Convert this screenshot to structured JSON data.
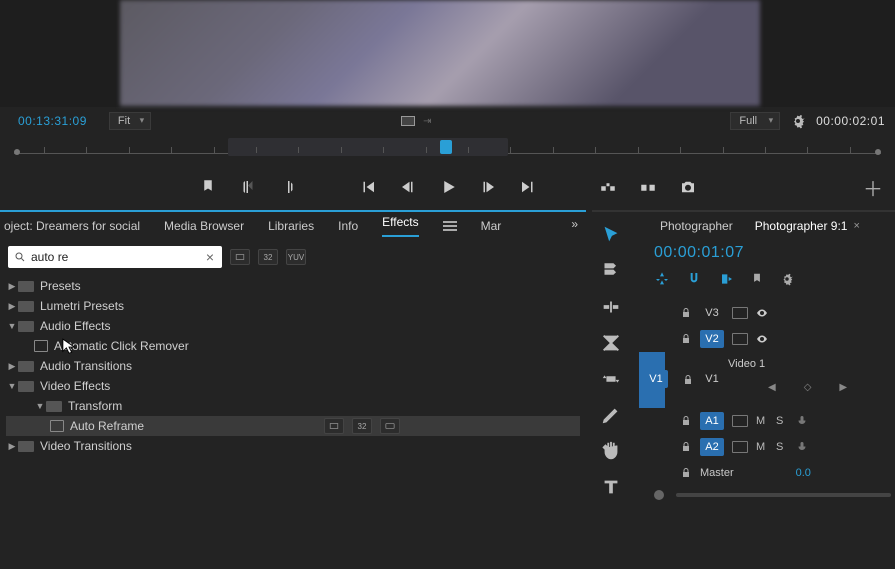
{
  "monitor": {
    "left_timecode": "00:13:31:09",
    "zoom": "Fit",
    "resolution": "Full",
    "right_timecode": "00:00:02:01"
  },
  "panel_left": {
    "project_tab": "oject: Dreamers for social",
    "tabs": [
      "Media Browser",
      "Libraries",
      "Info",
      "Effects",
      "Mar"
    ],
    "active_tab": "Effects",
    "search_value": "auto re",
    "tree": {
      "presets": "Presets",
      "lumetri": "Lumetri Presets",
      "audio_fx": "Audio Effects",
      "auto_click": "Automatic Click Remover",
      "audio_tr": "Audio Transitions",
      "video_fx": "Video Effects",
      "transform": "Transform",
      "auto_reframe": "Auto Reframe",
      "video_tr": "Video Transitions"
    }
  },
  "timeline": {
    "tabs": [
      "Photographer",
      "Photographer 9:1"
    ],
    "active_tab": 1,
    "timecode": "00:00:01:07",
    "tracks": {
      "v3": "V3",
      "v2": "V2",
      "v1": "V1",
      "v1_src": "V1",
      "clip": "Video 1",
      "a1": "A1",
      "a2": "A2",
      "master": "Master",
      "master_val": "0.0",
      "m": "M",
      "s": "S"
    }
  }
}
